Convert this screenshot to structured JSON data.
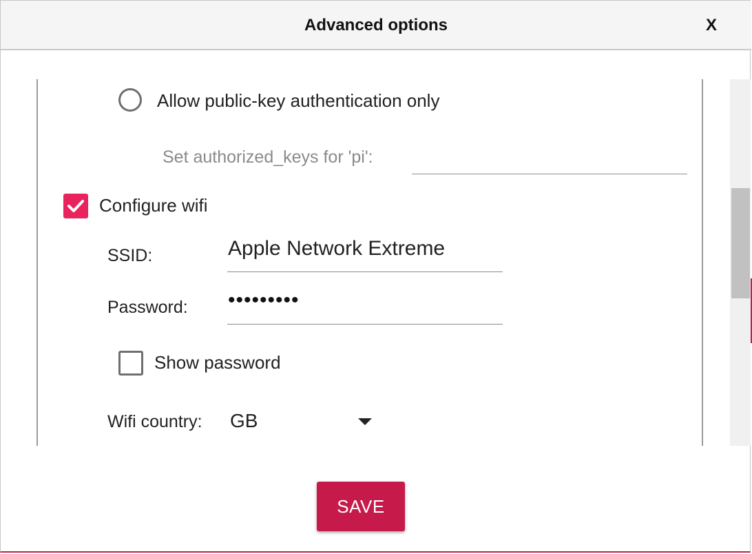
{
  "dialog": {
    "title": "Advanced options",
    "close_label": "X"
  },
  "ssh": {
    "pubkey_radio_label": "Allow public-key authentication only",
    "pubkey_radio_selected": false,
    "authorized_keys_label": "Set authorized_keys for 'pi':",
    "authorized_keys_value": ""
  },
  "wifi": {
    "configure_label": "Configure wifi",
    "configure_checked": true,
    "ssid_label": "SSID:",
    "ssid_value": "Apple Network Extreme",
    "password_label": "Password:",
    "password_mask": "•••••••••",
    "show_password_label": "Show password",
    "show_password_checked": false,
    "country_label": "Wifi country:",
    "country_value": "GB"
  },
  "footer": {
    "save_label": "SAVE"
  },
  "colors": {
    "accent": "#c51a4a",
    "checkbox": "#e8235e"
  }
}
